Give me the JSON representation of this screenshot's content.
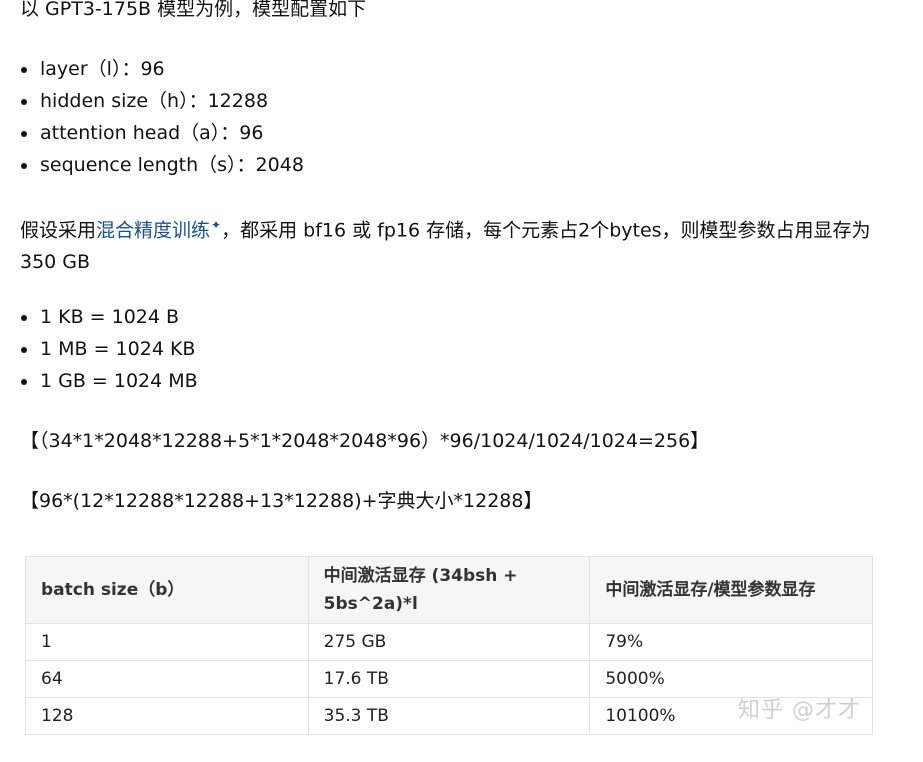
{
  "intro": "以 GPT3-175B 模型为例，模型配置如下",
  "config_items": [
    "layer（l）：96",
    "hidden size（h）：12288",
    "attention head（a）：96",
    "sequence length（s）：2048"
  ],
  "para2": {
    "prefix": "假设采用",
    "link": "混合精度训练",
    "spark": "✦",
    "suffix": "，都采用 bf16 或 fp16 存储，每个元素占2个bytes，则模型参数占用显存为 350 GB"
  },
  "units": [
    "1 KB = 1024 B",
    "1 MB = 1024 KB",
    "1 GB = 1024 MB"
  ],
  "formula1": "【（34*1*2048*12288+5*1*2048*2048*96）*96/1024/1024/1024=256】",
  "formula2": "【96*(12*12288*12288+13*12288)+字典大小*12288】",
  "table": {
    "headers": [
      "batch size（b）",
      "中间激活显存 (34bsh + 5bs^2a)*l",
      "中间激活显存/模型参数显存"
    ],
    "rows": [
      [
        "1",
        "275 GB",
        "79%"
      ],
      [
        "64",
        "17.6 TB",
        "5000%"
      ],
      [
        "128",
        "35.3 TB",
        "10100%"
      ]
    ]
  },
  "watermark": "知乎 @才才"
}
